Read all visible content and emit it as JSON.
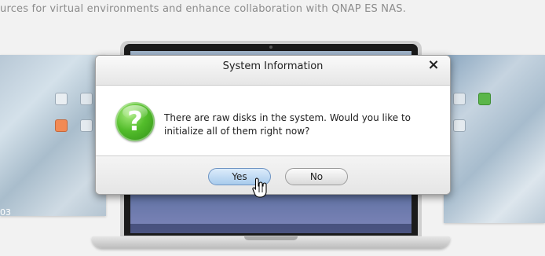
{
  "background": {
    "marketing_text_top": "",
    "marketing_text": "urces for virtual environments and enhance collaboration with QNAP ES NAS.",
    "left_screen_number": "03"
  },
  "dialog": {
    "title": "System Information",
    "close_label": "×",
    "message": "There are raw disks in the system. Would you like to initialize all of them right now?",
    "icon_glyph": "?",
    "icon_color": "#4caf2a",
    "yes_label": "Yes",
    "no_label": "No"
  },
  "colors": {
    "yes_button_accent": "#a8cbec",
    "laptop_screen": "#7d95b7"
  }
}
